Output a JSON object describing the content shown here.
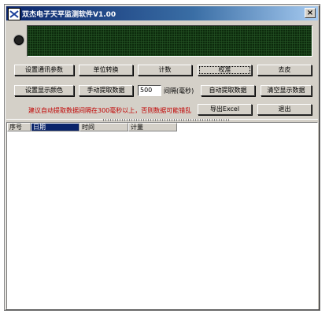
{
  "window": {
    "title": "双杰电子天平监测软件V1.00",
    "close_glyph": "×"
  },
  "buttons": {
    "row1": [
      "设置通讯参数",
      "单位转换",
      "计数",
      "校准",
      "去皮"
    ],
    "row2": [
      "设置显示颜色",
      "手动提取数据",
      "自动提取数据",
      "清空显示数据"
    ],
    "export": "导出Excel",
    "exit": "退出"
  },
  "interval": {
    "value": "500",
    "label": "间隔(毫秒)"
  },
  "warning": "建议自动提取数据间隔在300毫秒以上，否则数据可能错乱",
  "table": {
    "columns": [
      "序号",
      "日期",
      "时间",
      "计量"
    ],
    "selected_column": 1
  },
  "colors": {
    "title_bar": "#0a246a",
    "lcd_background": "#0c2a0c",
    "warning_text": "#c00000",
    "face": "#d4d0c8"
  },
  "icons": {
    "app": "balance-scale-icon",
    "indicator": "status-light-icon"
  }
}
